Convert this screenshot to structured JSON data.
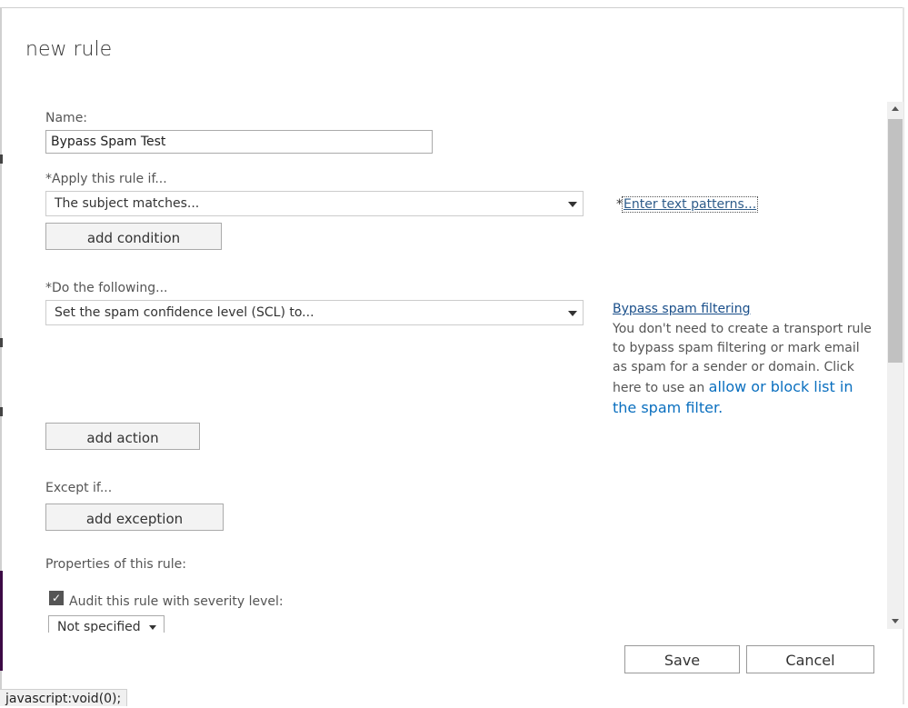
{
  "dialog": {
    "title": "new rule"
  },
  "name_field": {
    "label": "Name:",
    "value": "Bypass Spam Test"
  },
  "condition": {
    "label": "*Apply this rule if...",
    "selected": "The subject matches...",
    "required_marker": "*",
    "link": "Enter text patterns...",
    "add_button": "add condition"
  },
  "action": {
    "label": "*Do the following...",
    "selected": "Set the spam confidence level (SCL) to...",
    "add_button": "add action"
  },
  "help": {
    "title": "Bypass spam filtering",
    "text": "You don't need to create a transport rule to bypass spam filtering or mark email as spam for a sender or domain. Click here to use an ",
    "link": "allow or block list in the spam filter",
    "suffix": "."
  },
  "exception": {
    "label": "Except if...",
    "add_button": "add exception"
  },
  "properties": {
    "label": "Properties of this rule:",
    "audit_label": "Audit this rule with severity level:",
    "audit_checked": true,
    "severity_value": "Not specified"
  },
  "footer": {
    "save": "Save",
    "cancel": "Cancel"
  },
  "status_bar": {
    "text": "javascript:void(0);"
  }
}
